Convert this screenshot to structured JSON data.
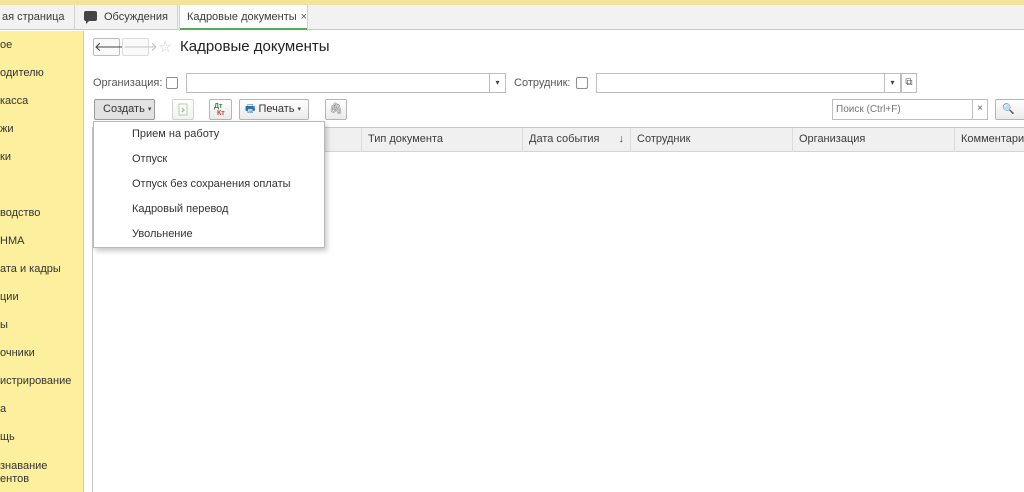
{
  "tabs": [
    {
      "label": "ая страница"
    },
    {
      "label": "Обсуждения",
      "icon": "chat-icon"
    },
    {
      "label": "Кадровые документы",
      "close": "×"
    }
  ],
  "sidebar": {
    "items": [
      {
        "label": "ое"
      },
      {
        "label": "одителю"
      },
      {
        "label": "касса"
      },
      {
        "label": "жи"
      },
      {
        "label": "ки"
      },
      {
        "label": "водство"
      },
      {
        "label": "НМА"
      },
      {
        "label": "ата и кадры"
      },
      {
        "label": "ции"
      },
      {
        "label": "ы"
      },
      {
        "label": "очники"
      },
      {
        "label": "истрирование"
      },
      {
        "label": "а"
      },
      {
        "label": "щь"
      },
      {
        "label": "знавание"
      },
      {
        "label": "ентов"
      }
    ]
  },
  "header": {
    "back_icon": "arrow-left-icon",
    "forward_icon": "arrow-right-icon",
    "back_glyph": "🡐",
    "forward_glyph": "🡒",
    "star_icon": "star-icon",
    "star_glyph": "☆",
    "title": "Кадровые документы"
  },
  "filters": {
    "organization_label": "Организация:",
    "organization_value": "",
    "employee_label": "Сотрудник:",
    "employee_value": "",
    "dropdown_glyph": "▾",
    "open_glyph": "⧉"
  },
  "toolbar": {
    "create_label": "Создать",
    "caret_glyph": "▾",
    "print_label": "Печать",
    "print_glyph": "🖶",
    "attach_glyph": "🖇",
    "search_placeholder": "Поиск (Ctrl+F)",
    "clear_glyph": "×",
    "search_glyph": "🔍"
  },
  "table": {
    "columns": [
      {
        "label": ""
      },
      {
        "label": "Тип документа"
      },
      {
        "label": "Дата события",
        "sort": "↓"
      },
      {
        "label": "Сотрудник"
      },
      {
        "label": "Организация"
      },
      {
        "label": "Комментарий"
      }
    ],
    "rows": []
  },
  "create_menu": {
    "items": [
      {
        "label": "Прием на работу"
      },
      {
        "label": "Отпуск"
      },
      {
        "label": "Отпуск без сохранения оплаты"
      },
      {
        "label": "Кадровый перевод"
      },
      {
        "label": "Увольнение"
      }
    ]
  },
  "colors": {
    "sidebar_bg": "#fcef9e",
    "active_tab_underline": "#4caf50",
    "top_band": "#f3e49a"
  }
}
